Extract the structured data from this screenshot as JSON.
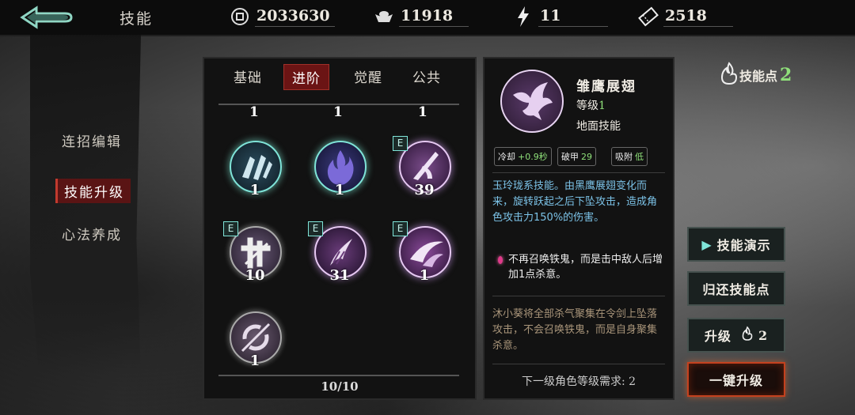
{
  "topbar": {
    "title": "技能",
    "back_icon": "back-arrow-icon",
    "resources": [
      {
        "icon": "coin-icon",
        "value": "2033630"
      },
      {
        "icon": "ingot-icon",
        "value": "11918"
      },
      {
        "icon": "lightning-icon",
        "value": "11"
      },
      {
        "icon": "ticket-icon",
        "value": "2518"
      }
    ]
  },
  "left_menu": {
    "items": [
      {
        "label": "连招编辑"
      },
      {
        "label": "技能升级",
        "active": true
      },
      {
        "label": "心法养成"
      }
    ]
  },
  "center": {
    "tabs": [
      {
        "label": "基础"
      },
      {
        "label": "进阶",
        "active": true
      },
      {
        "label": "觉醒"
      },
      {
        "label": "公共"
      }
    ],
    "top_row_levels": [
      "1",
      "1",
      "1"
    ],
    "skills": [
      {
        "icon": "wolf-claw-icon",
        "level": "1",
        "enhanced": false
      },
      {
        "icon": "flame-icon",
        "level": "1",
        "enhanced": false
      },
      {
        "icon": "slash-icon",
        "level": "39",
        "enhanced": true
      },
      {
        "icon": "blade-cross-icon",
        "level": "10",
        "enhanced": true
      },
      {
        "icon": "feather-spin-icon",
        "level": "31",
        "enhanced": true
      },
      {
        "icon": "crescent-icon",
        "level": "1",
        "enhanced": true
      },
      {
        "icon": "swirl-icon",
        "level": "1",
        "enhanced": false
      }
    ],
    "pager": "10/10"
  },
  "detail": {
    "icon": "eagle-icon",
    "name": "雏鹰展翅",
    "level_label": "等级",
    "level_value": "1",
    "type": "地面技能",
    "stats": [
      {
        "label": "冷却",
        "value": "+0.9秒"
      },
      {
        "label": "破甲",
        "value": "29"
      },
      {
        "label": "吸附",
        "value": "低"
      }
    ],
    "description": "玉玲珑系技能。由黑鹰展翅变化而来，旋转跃起之后下坠攻击，造成角色攻击力150%的伤害。",
    "extra": "不再召唤铁鬼，而是击中敌人后增加1点杀意。",
    "lore": "沐小葵将全部杀气聚集在令剑上坠落攻击，不会召唤铁鬼，而是自身聚集杀意。",
    "requirement": "下一级角色等级需求: 2"
  },
  "right": {
    "skill_points_label": "技能点",
    "skill_points_value": "2",
    "skill_points_icon": "spirit-flame-icon",
    "demo_button": "技能演示",
    "refund_button": "归还技能点",
    "upgrade_label": "升级",
    "upgrade_cost": "2",
    "one_click_button": "一键升级"
  },
  "colors": {
    "accent_green": "#8fe07a",
    "desc_blue": "#7cc3e8",
    "lore_brown": "#a9957a",
    "active_red": "#6b1414"
  }
}
